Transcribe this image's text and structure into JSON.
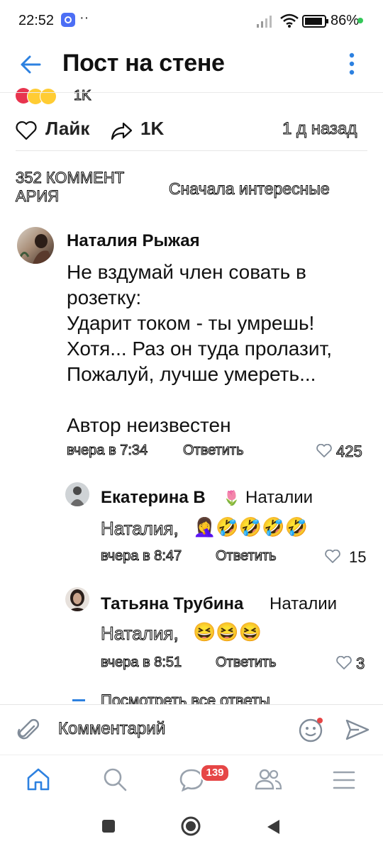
{
  "status_bar": {
    "time": "22:52",
    "dots": "··",
    "battery": "86%"
  },
  "header": {
    "title": "Пост на стене"
  },
  "post": {
    "reactions_count": "1K",
    "like_label": "Лайк",
    "share_count": "1K",
    "time_ago": "1 д назад"
  },
  "comments_section": {
    "count_label_line1": "352 КОММЕНТ",
    "count_label_line2": "АРИЯ",
    "sort_label": "Сначала интересные"
  },
  "comment": {
    "author": "Наталия Рыжая",
    "text_lines": [
      "Не вздумай член совать в",
      "розетку:",
      "Ударит током - ты умрешь!",
      "Хотя... Раз он туда пролазит,",
      "Пожалуй, лучше умереть...",
      "",
      "Автор неизвестен"
    ],
    "time": "вчера в 7:34",
    "reply_label": "Ответить",
    "likes": "425"
  },
  "replies": [
    {
      "author": "Екатерина В",
      "to": "Наталии",
      "text": "Наталия,",
      "emojis": "🤦‍♀️🤣🤣🤣🤣",
      "time": "вчера в 8:47",
      "reply_label": "Ответить",
      "likes": "15"
    },
    {
      "author": "Татьяна Трубина",
      "to": "Наталии",
      "text": "Наталия,",
      "emojis": "😆😆😆",
      "time": "вчера в 8:51",
      "reply_label": "Ответить",
      "likes": "3"
    }
  ],
  "show_all_replies": "Посмотреть все ответы",
  "input": {
    "placeholder": "Комментарий"
  },
  "tabbar": {
    "messages_badge": "139"
  },
  "colors": {
    "accent": "#2d81e0",
    "badge": "#e64646",
    "text": "#111111",
    "muted": "#818c99"
  },
  "icons": [
    "back-arrow-icon",
    "more-vertical-icon",
    "heart-icon",
    "share-icon",
    "attach-icon",
    "emoji-icon",
    "send-icon",
    "home-icon",
    "search-icon",
    "messages-icon",
    "friends-icon",
    "menu-icon"
  ]
}
